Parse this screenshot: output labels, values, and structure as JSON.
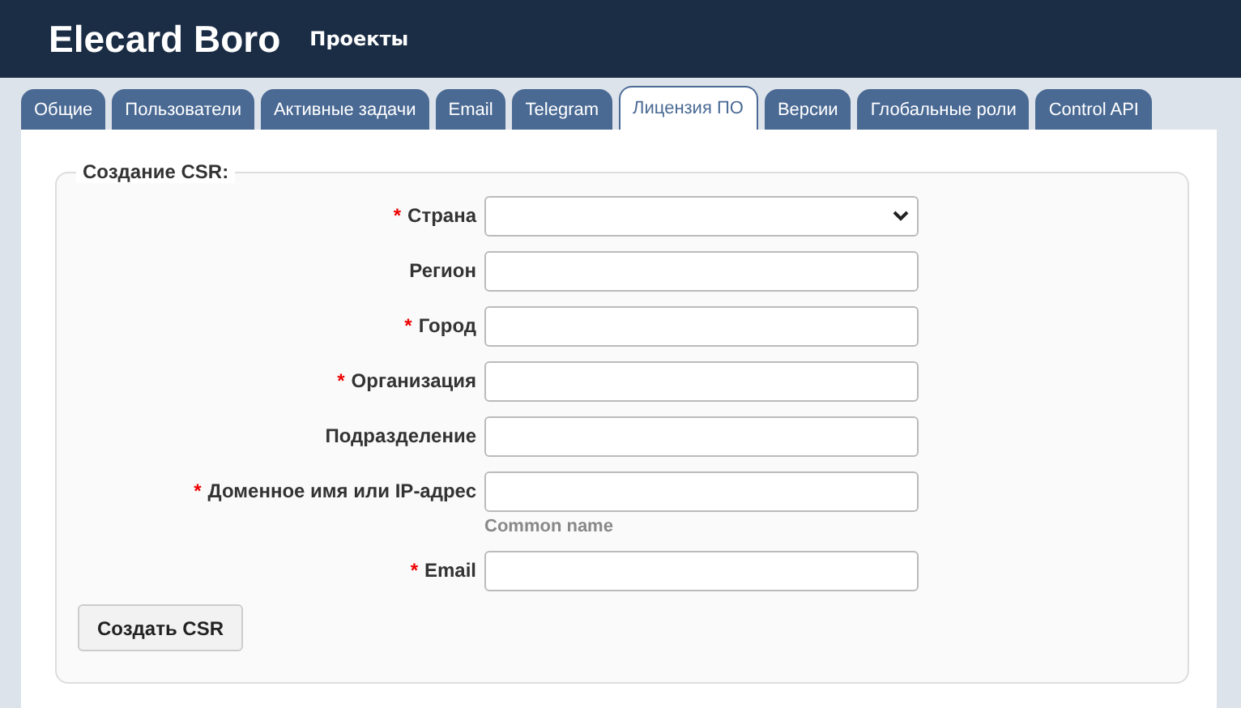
{
  "header": {
    "brand": "Elecard Boro",
    "nav": [
      "Проекты"
    ]
  },
  "tabs": [
    {
      "label": "Общие",
      "selected": false
    },
    {
      "label": "Пользователи",
      "selected": false
    },
    {
      "label": "Активные задачи",
      "selected": false
    },
    {
      "label": "Email",
      "selected": false
    },
    {
      "label": "Telegram",
      "selected": false
    },
    {
      "label": "Лицензия ПО",
      "selected": true
    },
    {
      "label": "Версии",
      "selected": false
    },
    {
      "label": "Глобальные роли",
      "selected": false
    },
    {
      "label": "Control API",
      "selected": false
    }
  ],
  "form": {
    "legend": "Создание CSR:",
    "fields": [
      {
        "kind": "select",
        "mark": "*",
        "label": "Страна"
      },
      {
        "kind": "text",
        "label": "Регион"
      },
      {
        "kind": "text",
        "mark": "*",
        "label": "Город"
      },
      {
        "kind": "text",
        "mark": "*",
        "label": "Организация"
      },
      {
        "kind": "text",
        "label": "Подразделение"
      },
      {
        "kind": "text",
        "mark": "*",
        "label": "Доменное имя или IP-адрес",
        "hint": "Common name"
      },
      {
        "kind": "text",
        "mark": "*",
        "label": "Email"
      }
    ],
    "submit": "Создать CSR"
  }
}
